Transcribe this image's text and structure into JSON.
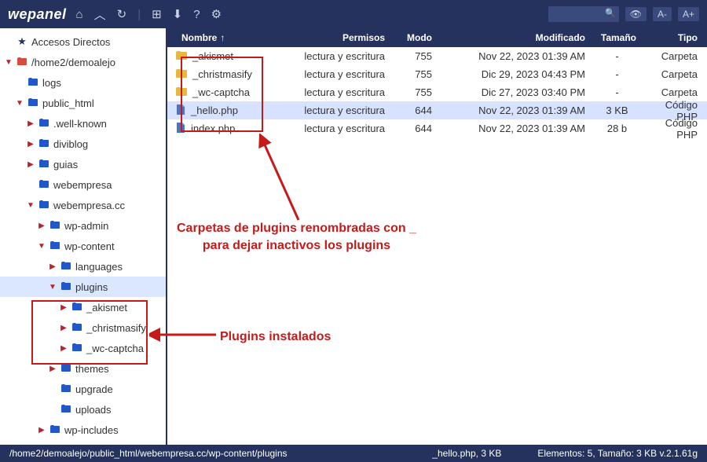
{
  "topbar": {
    "logo": "wepanel",
    "search_placeholder": ""
  },
  "sidebar": {
    "items": [
      {
        "indent": 0,
        "tog": "none",
        "icon": "star",
        "label": "Accesos Directos"
      },
      {
        "indent": 0,
        "tog": "open",
        "icon": "disk",
        "label": "/home2/demoalejo"
      },
      {
        "indent": 1,
        "tog": "none",
        "icon": "fold",
        "label": "logs"
      },
      {
        "indent": 1,
        "tog": "open",
        "icon": "fold-open",
        "label": "public_html"
      },
      {
        "indent": 2,
        "tog": "closed",
        "icon": "fold",
        "label": ".well-known"
      },
      {
        "indent": 2,
        "tog": "closed",
        "icon": "fold",
        "label": "diviblog"
      },
      {
        "indent": 2,
        "tog": "closed",
        "icon": "fold",
        "label": "guias"
      },
      {
        "indent": 2,
        "tog": "none",
        "icon": "fold",
        "label": "webempresa"
      },
      {
        "indent": 2,
        "tog": "open",
        "icon": "fold-open",
        "label": "webempresa.cc"
      },
      {
        "indent": 3,
        "tog": "closed",
        "icon": "fold",
        "label": "wp-admin"
      },
      {
        "indent": 3,
        "tog": "open",
        "icon": "fold-open",
        "label": "wp-content"
      },
      {
        "indent": 4,
        "tog": "closed",
        "icon": "fold",
        "label": "languages"
      },
      {
        "indent": 4,
        "tog": "open",
        "icon": "fold-open",
        "label": "plugins",
        "sel": true
      },
      {
        "indent": 5,
        "tog": "closed",
        "icon": "fold",
        "label": "_akismet"
      },
      {
        "indent": 5,
        "tog": "closed",
        "icon": "fold",
        "label": "_christmasify"
      },
      {
        "indent": 5,
        "tog": "closed",
        "icon": "fold",
        "label": "_wc-captcha"
      },
      {
        "indent": 4,
        "tog": "closed",
        "icon": "fold",
        "label": "themes"
      },
      {
        "indent": 4,
        "tog": "none",
        "icon": "fold",
        "label": "upgrade"
      },
      {
        "indent": 4,
        "tog": "none",
        "icon": "fold",
        "label": "uploads"
      },
      {
        "indent": 3,
        "tog": "closed",
        "icon": "fold",
        "label": "wp-includes"
      }
    ]
  },
  "table": {
    "headers": {
      "name": "Nombre",
      "perm": "Permisos",
      "mode": "Modo",
      "mod": "Modificado",
      "size": "Tamaño",
      "type": "Tipo"
    },
    "rows": [
      {
        "icon": "fold",
        "name": "_akismet",
        "perm": "lectura y escritura",
        "mode": "755",
        "mod": "Nov 22, 2023 01:39 AM",
        "size": "-",
        "type": "Carpeta"
      },
      {
        "icon": "fold",
        "name": "_christmasify",
        "perm": "lectura y escritura",
        "mode": "755",
        "mod": "Dic 29, 2023 04:43 PM",
        "size": "-",
        "type": "Carpeta"
      },
      {
        "icon": "fold",
        "name": "_wc-captcha",
        "perm": "lectura y escritura",
        "mode": "755",
        "mod": "Dic 27, 2023 03:40 PM",
        "size": "-",
        "type": "Carpeta"
      },
      {
        "icon": "file",
        "name": "_hello.php",
        "perm": "lectura y escritura",
        "mode": "644",
        "mod": "Nov 22, 2023 01:39 AM",
        "size": "3 KB",
        "type": "Código PHP",
        "sel": true
      },
      {
        "icon": "file",
        "name": "index.php",
        "perm": "lectura y escritura",
        "mode": "644",
        "mod": "Nov 22, 2023 01:39 AM",
        "size": "28 b",
        "type": "Código PHP"
      }
    ]
  },
  "status": {
    "path": "/home2/demoalejo/public_html/webempresa.cc/wp-content/plugins",
    "selected": "_hello.php, 3 KB",
    "info": "Elementos: 5, Tamaño: 3 KB v.2.1.61g"
  },
  "annotations": {
    "text1a": "Carpetas de plugins renombradas con _",
    "text1b": "para dejar inactivos los plugins",
    "text2": "Plugins instalados"
  }
}
